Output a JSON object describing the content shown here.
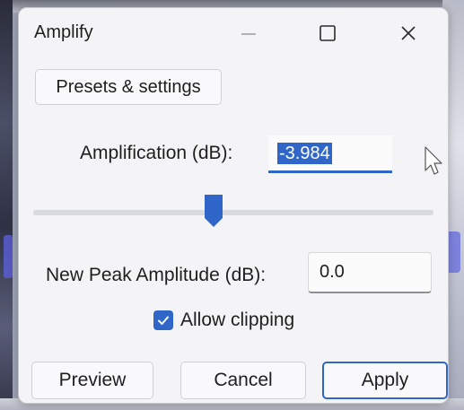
{
  "window": {
    "title": "Amplify",
    "controls": {
      "minimize_icon": "minimize-icon",
      "maximize_icon": "maximize-icon",
      "close_icon": "close-icon"
    }
  },
  "toolbar": {
    "presets_label": "Presets & settings"
  },
  "amplification": {
    "label": "Amplification (dB):",
    "value": "-3.984",
    "selected": true
  },
  "slider": {
    "fraction": 0.45
  },
  "peak": {
    "label": "New Peak Amplitude (dB):",
    "value": "0.0"
  },
  "clipping": {
    "label": "Allow clipping",
    "checked": true
  },
  "buttons": {
    "preview": "Preview",
    "cancel": "Cancel",
    "apply": "Apply"
  },
  "colors": {
    "accent": "#2f66c7",
    "dialog_bg": "#f4f4f6"
  }
}
